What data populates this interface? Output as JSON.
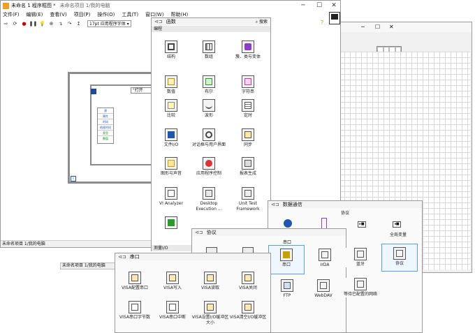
{
  "main_window": {
    "title": "未命名 1 程序框图 *",
    "subtitle": "未命名项目 1/我的电脑",
    "menus": [
      "文件(F)",
      "编辑(E)",
      "查看(V)",
      "项目(P)",
      "操作(O)",
      "工具(T)",
      "窗口(W)",
      "帮助(H)"
    ],
    "font_select": "17pt 应用程序字体",
    "status_text": "未命名项目 1/我的电脑",
    "case_selector": "\"打开"
  },
  "functions_palette": {
    "title": "函数",
    "search_label": "搜索",
    "category": "编程",
    "items": [
      "结构",
      "数组",
      "簇、类与变体",
      "数值",
      "布尔",
      "字符串",
      "比较",
      "波形",
      "定时",
      "文件I/O",
      "对话框与用户界面",
      "同步",
      "图形与声音",
      "应用程序控制",
      "报表生成",
      "VI Analyzer",
      "Desktop Execution ...",
      "Unit Test Framework"
    ],
    "footer": "测量I/O"
  },
  "data_comm_palette": {
    "title": "数据通信",
    "subtitle": "协议",
    "items": [
      "全局变量",
      "协议"
    ]
  },
  "protocol_palette": {
    "title": "协议",
    "section": "串口",
    "items": [
      "串口",
      "IrDA",
      "蓝牙",
      "FTP",
      "WebDAV",
      "等待已配置的网络"
    ]
  },
  "serial_palette": {
    "title": "串口",
    "items": [
      "VISA配置串口",
      "VISA写入",
      "VISA读取",
      "VISA关闭",
      "VISA串口字节数",
      "VISA串口中断",
      "VISA设置I/O缓冲区大小",
      "VISA清空I/O缓冲区"
    ]
  },
  "front_panel": {
    "status_text": "未命名项目 1/我的电脑"
  },
  "cluster_elements": [
    "源",
    "属性",
    "时间",
    "结尾时间",
    "类型",
    "数值"
  ]
}
